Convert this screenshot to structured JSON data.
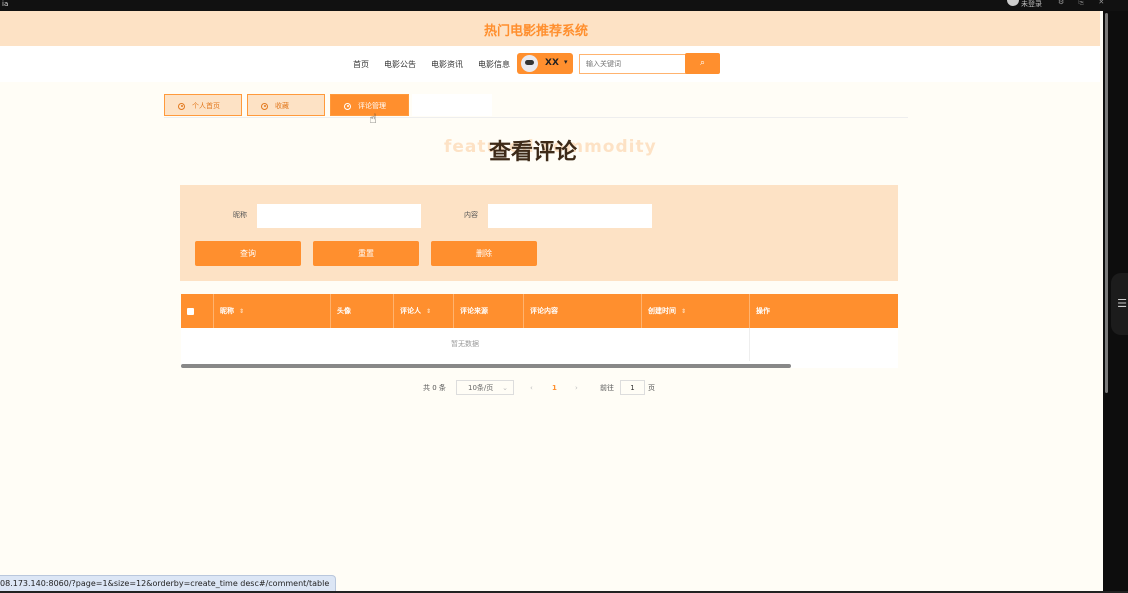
{
  "window": {
    "left_label": "ia",
    "user_label": "未登录",
    "icons": "⚙ ⎘ ✕"
  },
  "header": {
    "title": "热门电影推荐系统"
  },
  "nav": {
    "items": [
      "首页",
      "电影公告",
      "电影资讯",
      "电影信息"
    ],
    "username": "XX",
    "search_placeholder": "输入关键词"
  },
  "tabs": [
    {
      "label": "个人首页",
      "active": false
    },
    {
      "label": "收藏",
      "active": false
    },
    {
      "label": "评论管理",
      "active": true
    }
  ],
  "page": {
    "title": "查看评论",
    "watermark": "featured commodity"
  },
  "filters": {
    "nickname_label": "昵称",
    "content_label": "内容",
    "nickname_value": "",
    "content_value": "",
    "buttons": [
      "查询",
      "重置",
      "删除"
    ]
  },
  "table": {
    "columns": [
      "昵称",
      "头像",
      "评论人",
      "评论来源",
      "评论内容",
      "创建时间",
      "操作"
    ],
    "empty_text": "暂无数据"
  },
  "pagination": {
    "total": "共 0 条",
    "page_size": "10条/页",
    "current_page": "1",
    "goto_label": "前往",
    "goto_value": "1",
    "page_suffix": "页"
  },
  "statusbar": {
    "url": "08.173.140:8060/?page=1&size=12&orderby=create_time desc#/comment/table"
  },
  "colors": {
    "accent": "#ff8f2e",
    "accent_light": "#fde2c5",
    "title_dark": "#3d2a18"
  }
}
